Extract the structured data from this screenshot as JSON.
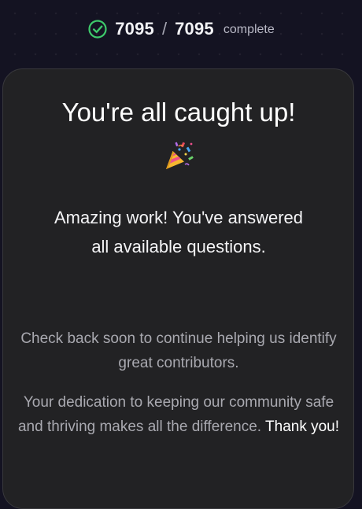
{
  "progress": {
    "done": "7095",
    "separator": "/",
    "total": "7095",
    "label": "complete",
    "icon": "check-circle-icon",
    "accent": "#3ec96b"
  },
  "card": {
    "title": "You're all caught up!",
    "emoji_icon": "party-popper-icon",
    "message": "Amazing work! You've answered all available questions.",
    "check_back": "Check back soon to continue helping us identify great contributors.",
    "dedication": "Your dedication to keeping our community safe and thriving makes all the difference.",
    "thanks": "Thank you!"
  },
  "colors": {
    "background": "#141322",
    "card": "#222224"
  }
}
